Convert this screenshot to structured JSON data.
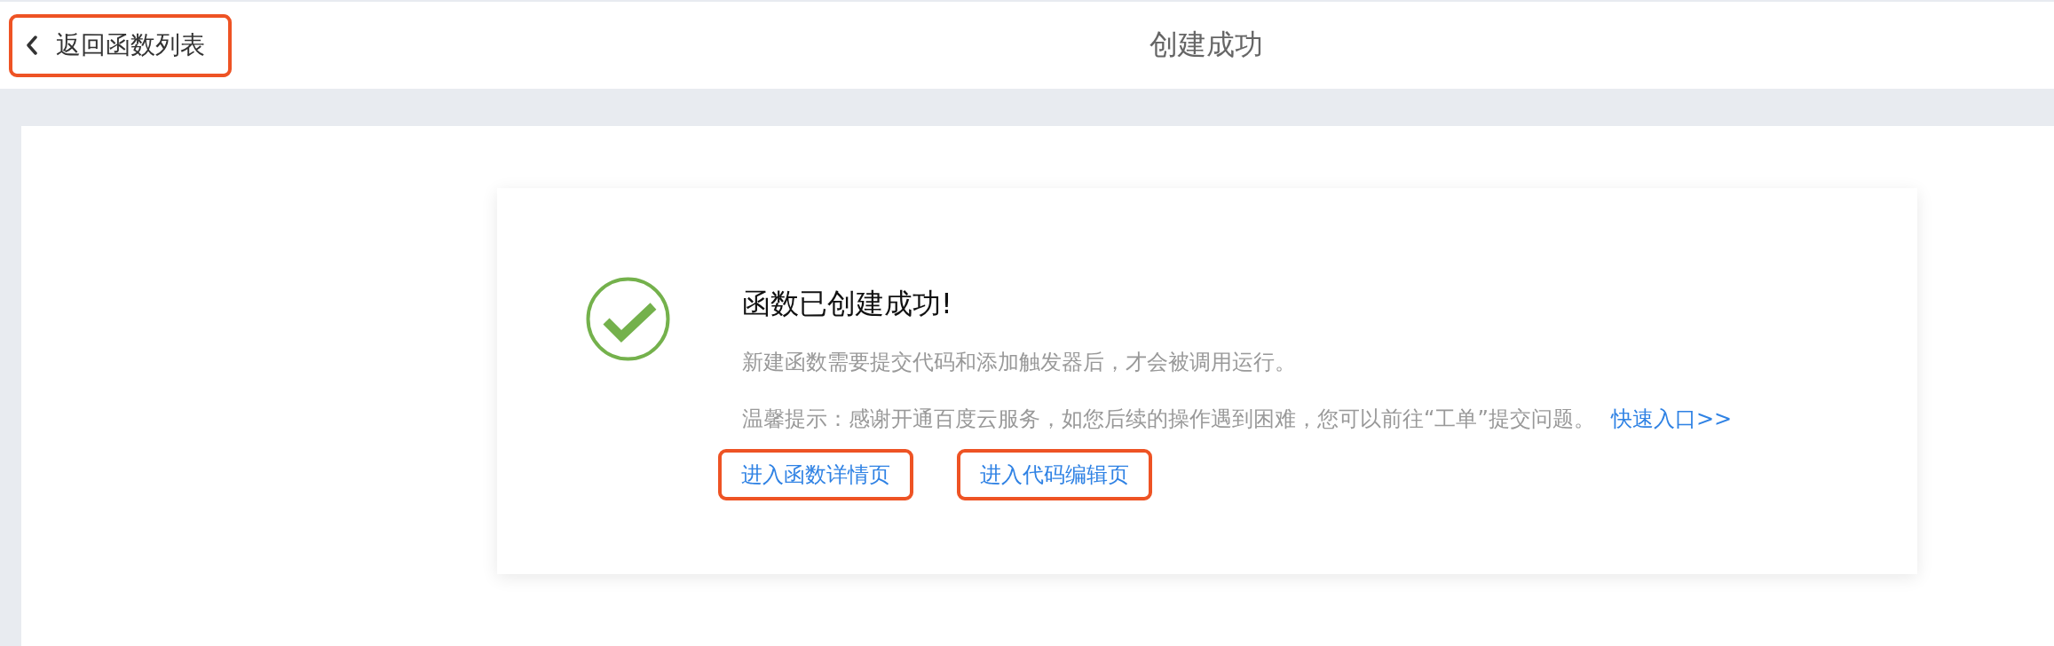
{
  "header": {
    "back_button": {
      "label": "返回函数列表",
      "highlighted": true
    },
    "title": "创建成功"
  },
  "result_card": {
    "kind": "success",
    "heading": "函数已创建成功!",
    "description": "新建函数需要提交代码和添加触发器后，才会被调用运行。",
    "tip": "温馨提示：感谢开通百度云服务，如您后续的操作遇到困难，您可以前往“工单”提交问题。",
    "tip_link": {
      "label": "快速入口>>",
      "highlighted": false
    },
    "actions": [
      {
        "label": "进入函数详情页",
        "highlighted": true
      },
      {
        "label": "进入代码编辑页",
        "highlighted": true
      }
    ]
  }
}
